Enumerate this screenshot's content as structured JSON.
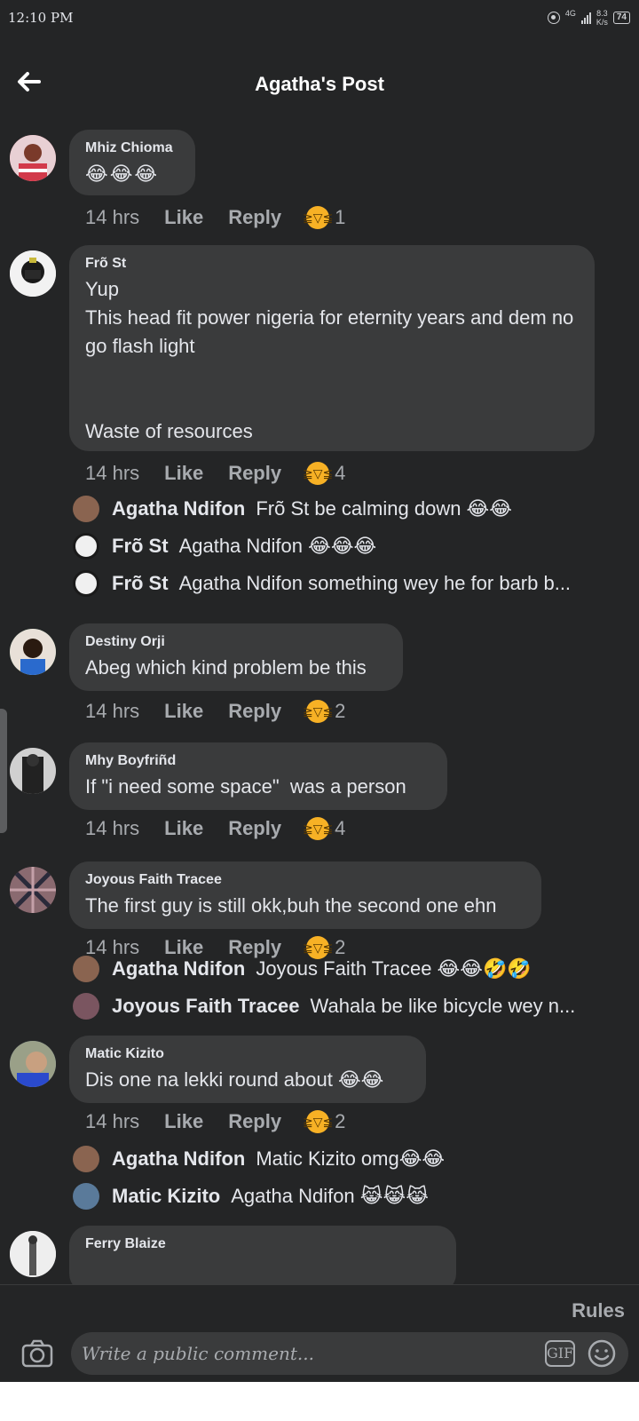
{
  "status_bar": {
    "time": "12:10 PM",
    "network": "4G",
    "speed": "8.3\nK/s",
    "battery": "74"
  },
  "header": {
    "title": "Agatha's Post",
    "back_icon": "arrow-left-icon"
  },
  "labels": {
    "like": "Like",
    "reply": "Reply"
  },
  "comments": [
    {
      "author": "Mhiz Chioma",
      "text": "😂😂😂",
      "time": "14 hrs",
      "reaction_count": "1",
      "avatar_color": "#c94a5a",
      "replies": []
    },
    {
      "author": "Frõ St",
      "text": "Yup\nThis head fit power nigeria for eternity years and dem no go flash light\n\n\nWaste of resources",
      "time": "14 hrs",
      "reaction_count": "4",
      "avatar_color": "#f0f0f0",
      "replies": [
        {
          "author": "Agatha Ndifon",
          "text": "Frõ St be calming down 😂😂",
          "avatar_color": "#8a6450"
        },
        {
          "author": "Frõ St",
          "text": "Agatha Ndifon 😂😂😂",
          "avatar_color": "#f0f0f0"
        },
        {
          "author": "Frõ St",
          "text": "Agatha Ndifon something wey he for barb b...",
          "avatar_color": "#f0f0f0"
        }
      ]
    },
    {
      "author": "Destiny Orji",
      "text": "Abeg which kind problem be this",
      "time": "14 hrs",
      "reaction_count": "2",
      "avatar_color": "#2b7a4a",
      "replies": []
    },
    {
      "author": "Mhy Boyfriñd",
      "text": "If \"i need some space\"  was a person",
      "time": "14 hrs",
      "reaction_count": "4",
      "avatar_color": "#4a4a4a",
      "replies": []
    },
    {
      "author": "Joyous Faith Tracee",
      "text": "The first guy is still okk,buh the second one ehn",
      "time": "14 hrs",
      "reaction_count": "2",
      "avatar_color": "#7a5560",
      "replies": [
        {
          "author": "Agatha Ndifon",
          "text": "Joyous Faith Tracee 😂😂🤣🤣",
          "avatar_color": "#8a6450"
        },
        {
          "author": "Joyous Faith Tracee",
          "text": "Wahala be like bicycle wey n...",
          "avatar_color": "#7a5560"
        }
      ]
    },
    {
      "author": "Matic Kizito",
      "text": "Dis one na lekki round about 😂😂",
      "time": "14 hrs",
      "reaction_count": "2",
      "avatar_color": "#5a7a9a",
      "replies": [
        {
          "author": "Agatha Ndifon",
          "text": "Matic Kizito omg😂😂",
          "avatar_color": "#8a6450"
        },
        {
          "author": "Matic Kizito",
          "text": "Agatha Ndifon 😹😹😹",
          "avatar_color": "#5a7a9a"
        }
      ]
    },
    {
      "author": "Ferry Blaize",
      "text": "",
      "avatar_color": "#d8d8d8",
      "replies": []
    }
  ],
  "composer": {
    "rules": "Rules",
    "placeholder": "Write a public comment...",
    "gif_label": "GIF",
    "camera_icon": "camera-icon",
    "emoji_icon": "smiley-icon"
  }
}
